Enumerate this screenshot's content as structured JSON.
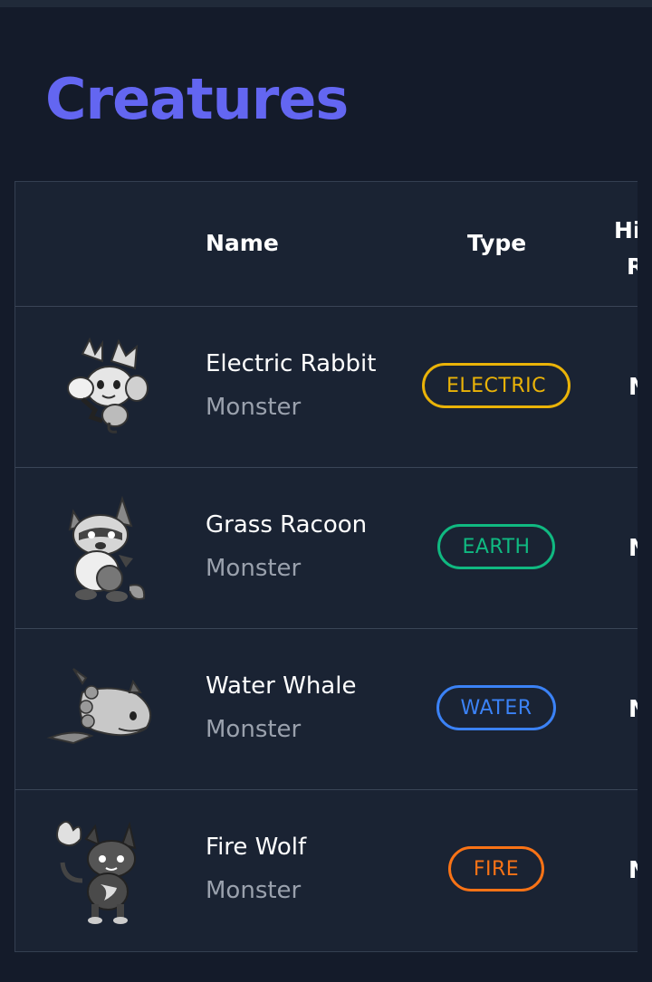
{
  "page": {
    "title": "Creatures"
  },
  "table": {
    "headers": {
      "name": "Name",
      "type": "Type",
      "hi_line1": "Hi",
      "hi_line2": "R"
    },
    "rows": [
      {
        "name": "Electric Rabbit",
        "sub": "Monster",
        "type": "ELECTRIC",
        "type_color": "#eab308",
        "trunc": "N",
        "icon": "electric-rabbit-icon"
      },
      {
        "name": "Grass Racoon",
        "sub": "Monster",
        "type": "EARTH",
        "type_color": "#10b981",
        "trunc": "N",
        "icon": "grass-racoon-icon"
      },
      {
        "name": "Water Whale",
        "sub": "Monster",
        "type": "WATER",
        "type_color": "#3b82f6",
        "trunc": "N",
        "icon": "water-whale-icon"
      },
      {
        "name": "Fire Wolf",
        "sub": "Monster",
        "type": "FIRE",
        "type_color": "#f97316",
        "trunc": "N",
        "icon": "fire-wolf-icon"
      }
    ]
  }
}
